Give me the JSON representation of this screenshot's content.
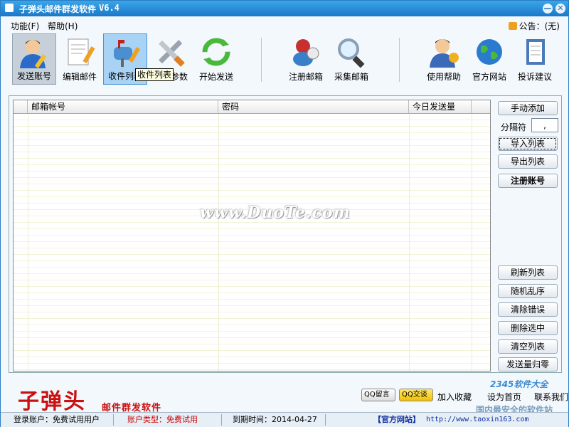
{
  "window": {
    "title": "子弹头邮件群发软件",
    "version": "V6.4",
    "min": "—",
    "close": "✕"
  },
  "menu": {
    "items": [
      "功能(F)",
      "帮助(H)"
    ],
    "notice": "公告：(无)"
  },
  "toolbar": {
    "items": [
      {
        "label": "发送账号",
        "icon": "user-pen-icon",
        "state": "pressed"
      },
      {
        "label": "编辑邮件",
        "icon": "document-pen-icon",
        "state": "normal"
      },
      {
        "label": "收件列表",
        "icon": "mailbox-icon",
        "state": "active"
      },
      {
        "label": "设置参数",
        "icon": "tools-icon",
        "state": "normal"
      },
      {
        "label": "开始发送",
        "icon": "refresh-icon",
        "state": "normal"
      },
      {
        "label": "注册邮箱",
        "icon": "register-icon",
        "state": "normal"
      },
      {
        "label": "采集邮箱",
        "icon": "magnifier-icon",
        "state": "normal"
      },
      {
        "label": "使用帮助",
        "icon": "help-user-icon",
        "state": "normal"
      },
      {
        "label": "官方网站",
        "icon": "globe-icon",
        "state": "normal"
      },
      {
        "label": "投诉建议",
        "icon": "notebook-icon",
        "state": "normal"
      }
    ],
    "tooltip": "收件列表"
  },
  "table": {
    "columns": [
      "邮箱帐号",
      "密码",
      "今日发送量"
    ]
  },
  "side": {
    "manual_add": "手动添加",
    "separator_label": "分隔符",
    "separator_value": ",",
    "import_list": "导入列表",
    "export_list": "导出列表",
    "register_account": "注册账号",
    "refresh_list": "刷新列表",
    "shuffle": "随机乱序",
    "clear_errors": "清除错误",
    "delete_selected": "删除选中",
    "clear_list": "清空列表",
    "reset_count": "发送量归零"
  },
  "watermark": "www.DuoTe.com",
  "brand": {
    "name": "子弹头",
    "sub": "邮件群发软件"
  },
  "bottom_links": {
    "qq_msg": "QQ留言",
    "qq_talk": "QQ交谈",
    "favorite": "加入收藏",
    "homepage": "设为首页",
    "contact": "联系我们"
  },
  "corner_watermark": {
    "line1": "2345软件大全",
    "line2": "国内最安全的软件站"
  },
  "status": {
    "login": "登录账户：免费试用用户",
    "account_type": "账户类型：免费试用",
    "expire": "到期时间：2014-04-27",
    "official": "【官方网站】",
    "url": "http://www.taoxin163.com"
  }
}
